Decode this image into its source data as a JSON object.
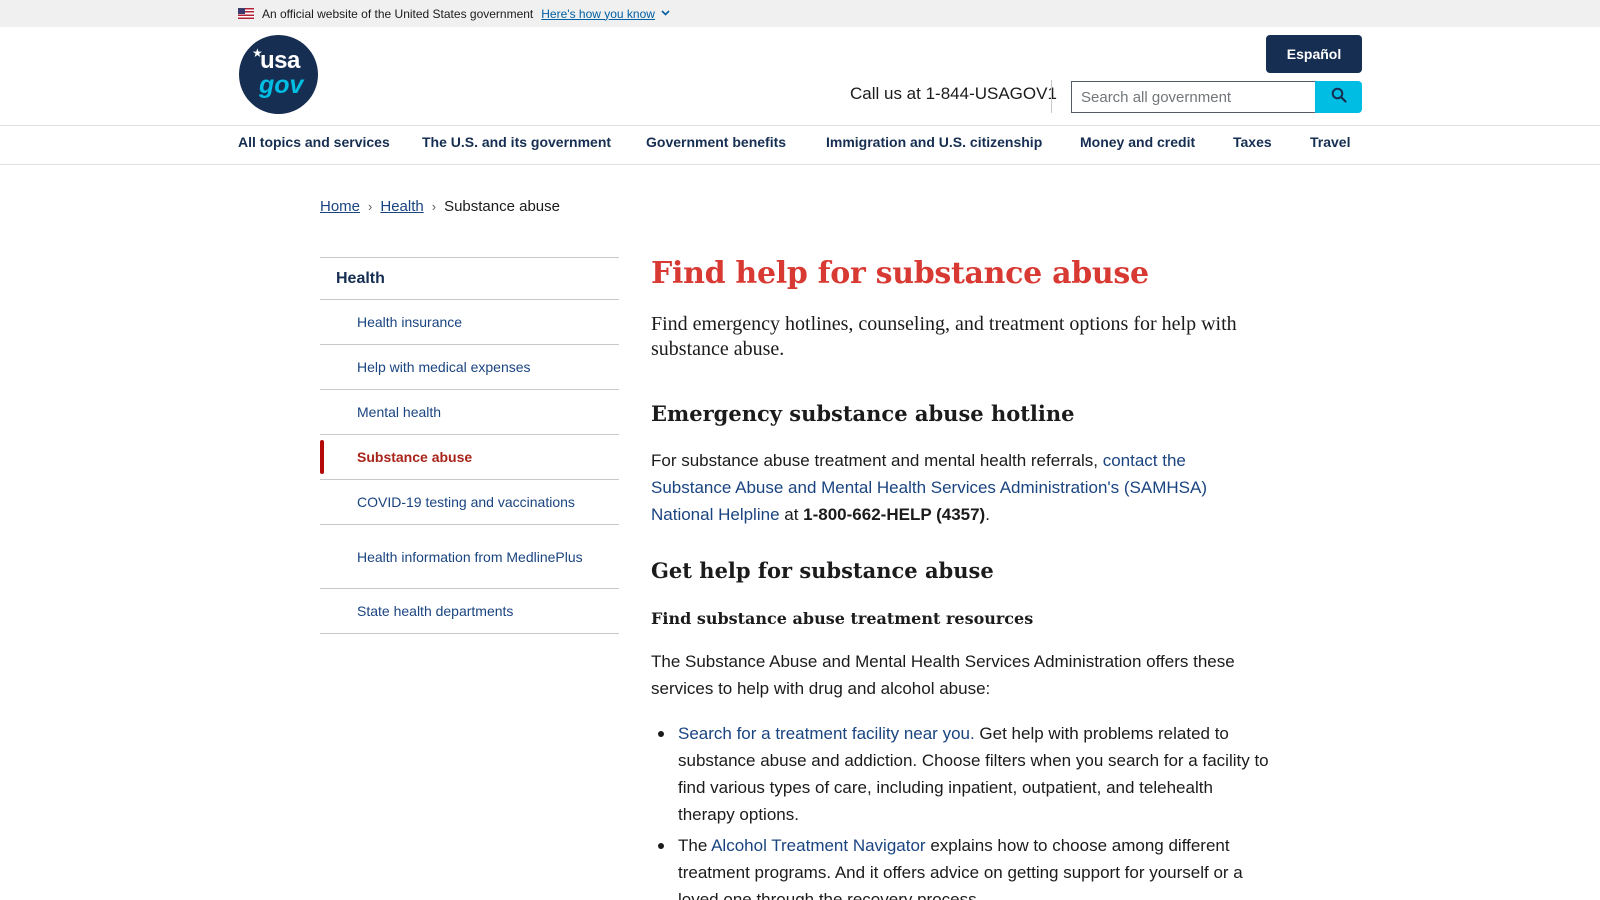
{
  "gov_banner": {
    "official_text": "An official website of the United States government",
    "how_you_know_link": "Here's how you know"
  },
  "header": {
    "logo_text_top": "usa",
    "logo_text_bottom": "gov",
    "language_button": "Español",
    "phone_text": "Call us at 1-844-USAGOV1",
    "search_placeholder": "Search all government"
  },
  "nav": {
    "items": [
      "All topics and services",
      "The U.S. and its government",
      "Government benefits",
      "Immigration and U.S. citizenship",
      "Money and credit",
      "Taxes",
      "Travel"
    ]
  },
  "breadcrumb": {
    "items": [
      "Home",
      "Health"
    ],
    "current": "Substance abuse"
  },
  "sidenav": {
    "parent": "Health",
    "children": [
      "Health insurance",
      "Help with medical expenses",
      "Mental health",
      "Substance abuse",
      "COVID-19 testing and vaccinations",
      "Health information from MedlinePlus",
      "State health departments"
    ],
    "current_index": 3
  },
  "main": {
    "title": "Find help for substance abuse",
    "lead": "Find emergency hotlines, counseling, and treatment options for help with substance abuse.",
    "section1": {
      "heading": "Emergency substance abuse hotline",
      "text_before": "For substance abuse treatment and mental health referrals, ",
      "link": "contact the Substance Abuse and Mental Health Services Administration's (SAMHSA) National Helpline",
      "text_mid": " at ",
      "phone": "1-800-662-HELP (4357)",
      "text_after": "."
    },
    "section2": {
      "heading": "Get help for substance abuse",
      "subheading": "Find substance abuse treatment resources",
      "intro": "The Substance Abuse and Mental Health Services Administration offers these services to help with drug and alcohol abuse:",
      "bullets": [
        {
          "prefix": "",
          "link": "Search for a treatment facility near you.",
          "text": " Get help with problems related to substance abuse and addiction. Choose filters when you search for a facility to find various types of care, including inpatient, outpatient, and telehealth therapy options."
        },
        {
          "prefix": "The ",
          "link": "Alcohol Treatment Navigator",
          "text": " explains how to choose among different treatment programs. And it offers advice on getting support for yourself or a loved one through the recovery process."
        }
      ]
    }
  }
}
